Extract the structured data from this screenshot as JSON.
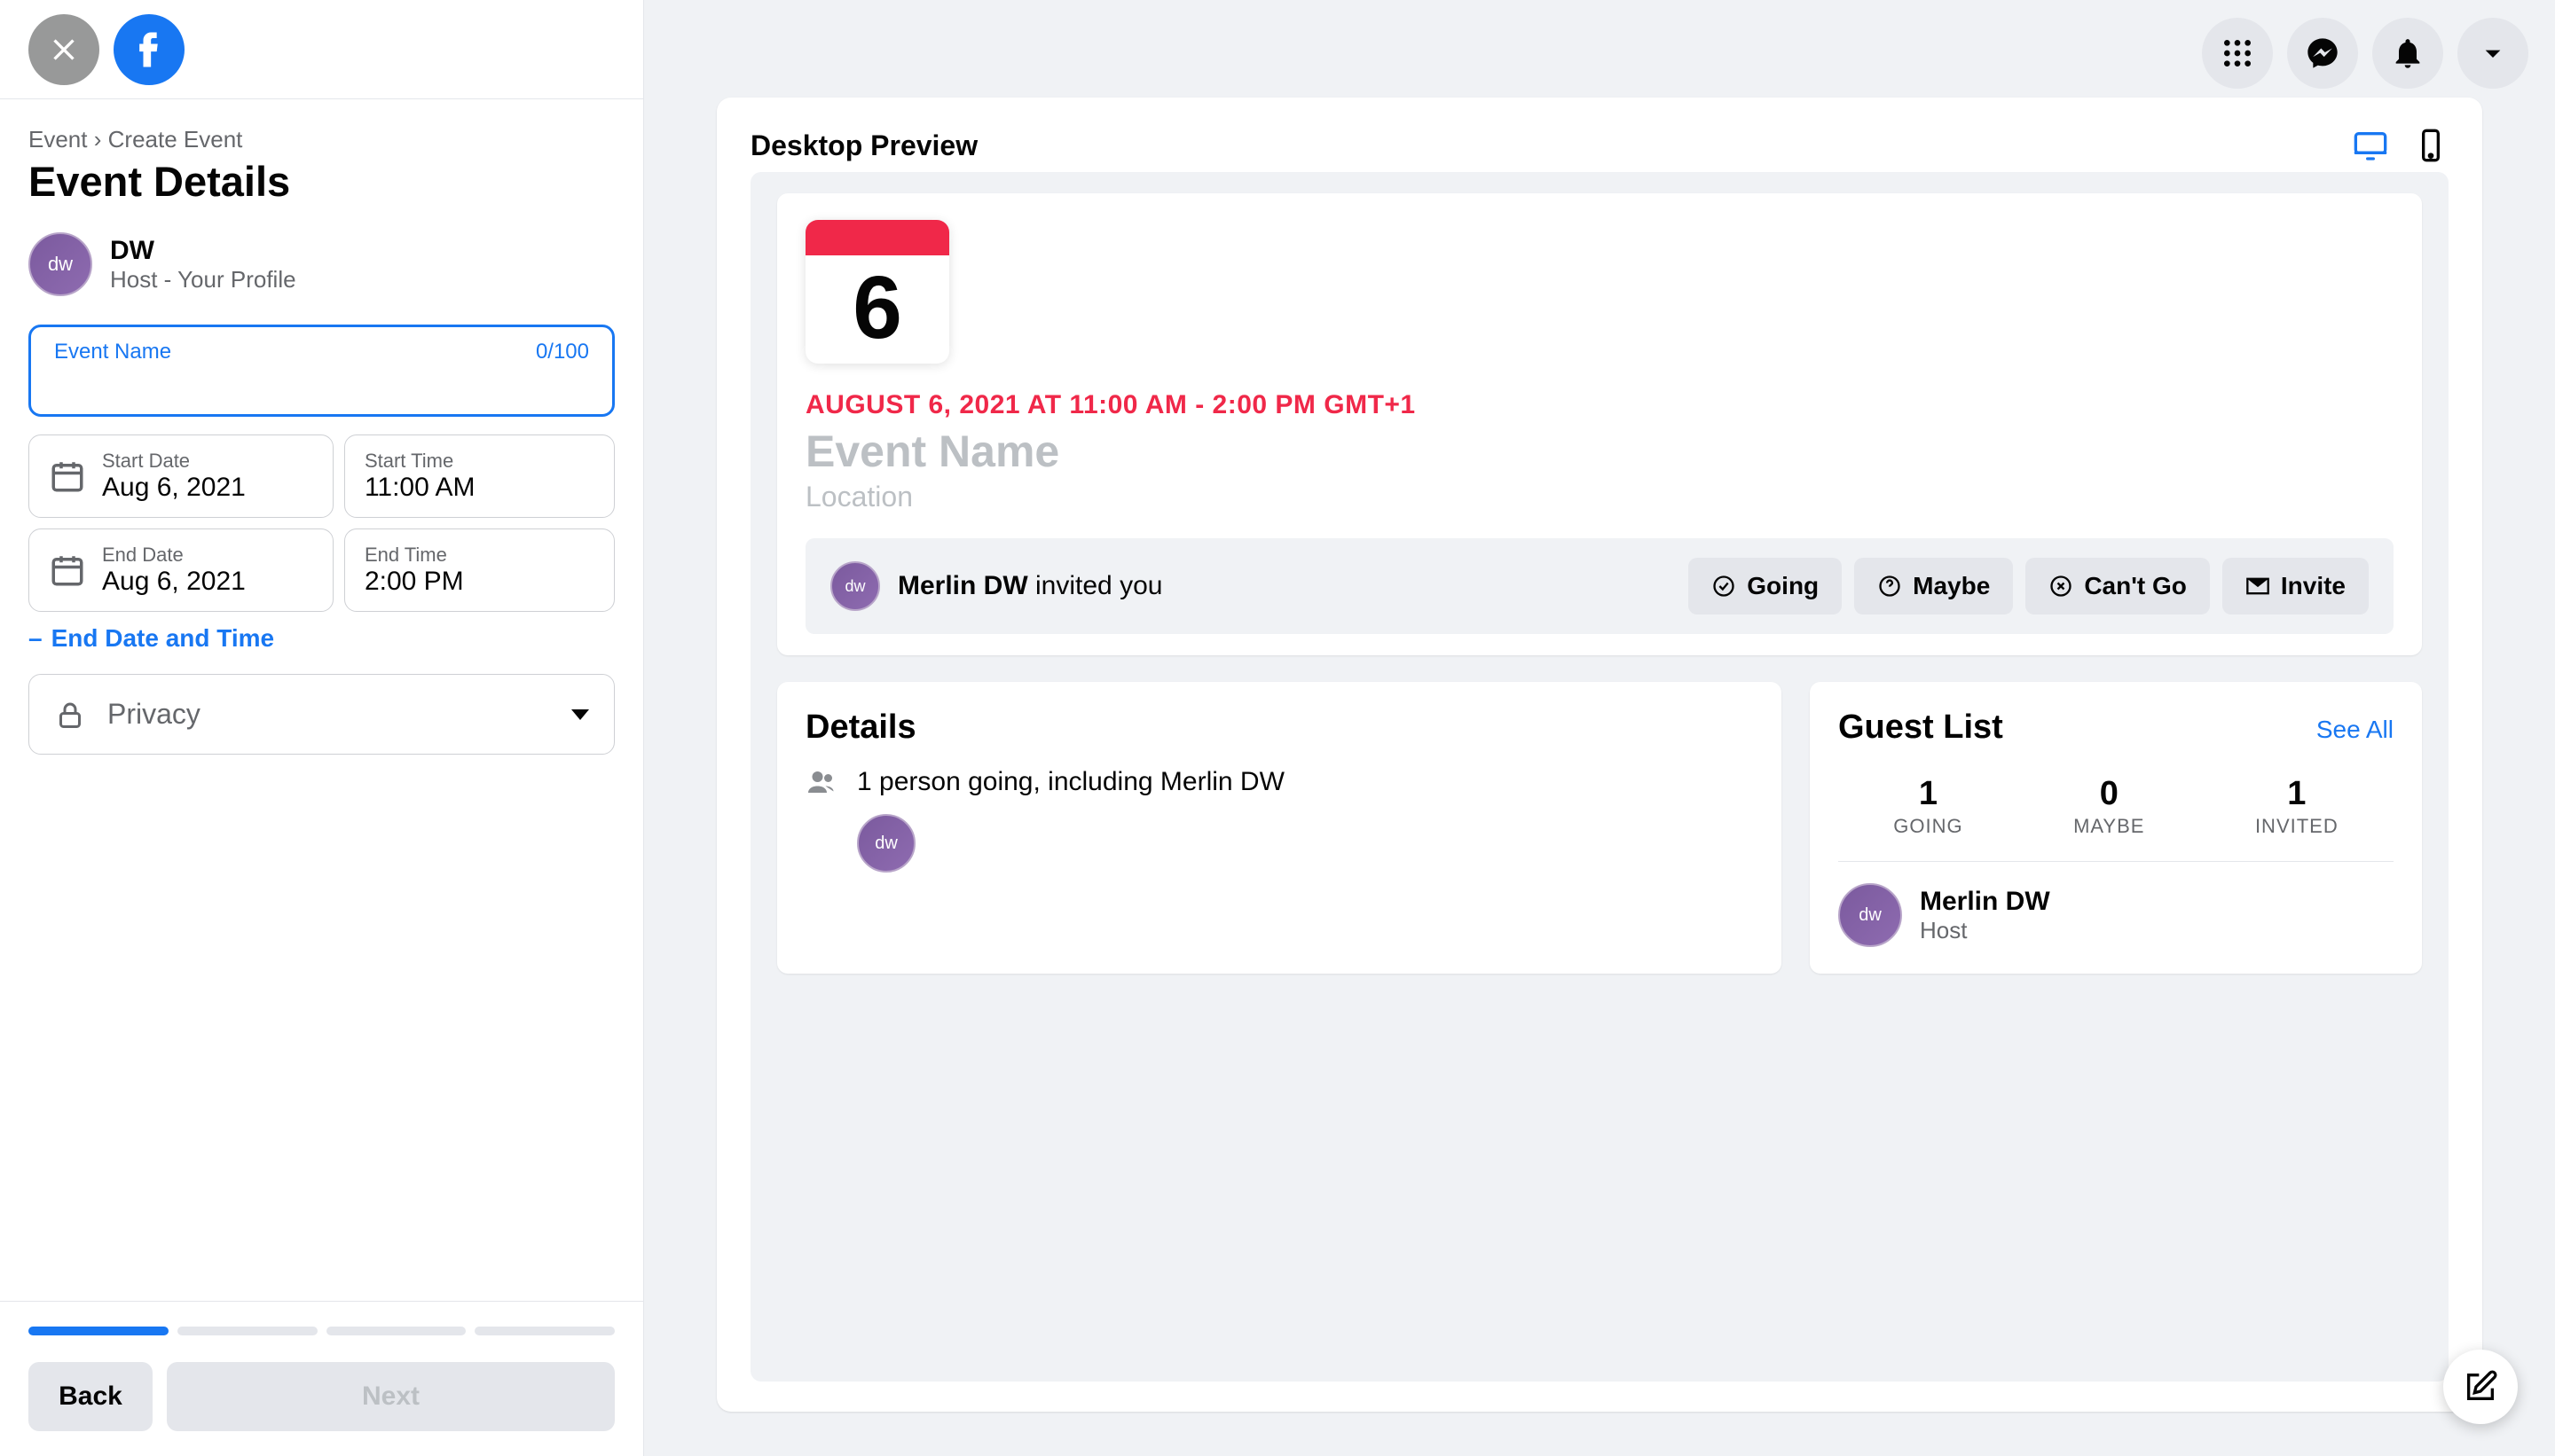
{
  "breadcrumb": {
    "root": "Event",
    "sep": "›",
    "current": "Create Event"
  },
  "title": "Event Details",
  "host": {
    "name": "DW",
    "subtitle": "Host - Your Profile",
    "initials": "dw"
  },
  "eventName": {
    "label": "Event Name",
    "counter": "0/100",
    "value": ""
  },
  "dates": {
    "startDate": {
      "label": "Start Date",
      "value": "Aug 6, 2021"
    },
    "startTime": {
      "label": "Start Time",
      "value": "11:00 AM"
    },
    "endDate": {
      "label": "End Date",
      "value": "Aug 6, 2021"
    },
    "endTime": {
      "label": "End Time",
      "value": "2:00 PM"
    }
  },
  "removeEnd": "End Date and Time",
  "privacy": {
    "label": "Privacy"
  },
  "buttons": {
    "back": "Back",
    "next": "Next"
  },
  "preview": {
    "title": "Desktop Preview",
    "calDay": "6",
    "dateLine": "AUGUST 6, 2021 AT 11:00 AM - 2:00 PM GMT+1",
    "eventName": "Event Name",
    "location": "Location",
    "inviter": "Merlin DW",
    "invitedText": "invited you",
    "rsvp": {
      "going": "Going",
      "maybe": "Maybe",
      "cant": "Can't Go",
      "invite": "Invite"
    },
    "details": {
      "heading": "Details",
      "goingText": "1 person going, including Merlin DW"
    },
    "guests": {
      "heading": "Guest List",
      "seeAll": "See All",
      "stats": {
        "going": {
          "n": "1",
          "l": "GOING"
        },
        "maybe": {
          "n": "0",
          "l": "MAYBE"
        },
        "invited": {
          "n": "1",
          "l": "INVITED"
        }
      },
      "list": [
        {
          "name": "Merlin DW",
          "role": "Host",
          "initials": "dw"
        }
      ]
    }
  }
}
